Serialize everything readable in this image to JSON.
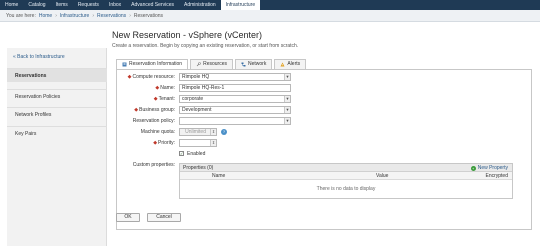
{
  "topnav": {
    "tabs": [
      {
        "label": "Home",
        "active": false
      },
      {
        "label": "Catalog",
        "active": false
      },
      {
        "label": "Items",
        "active": false
      },
      {
        "label": "Requests",
        "active": false
      },
      {
        "label": "Inbox",
        "active": false
      },
      {
        "label": "Advanced Services",
        "active": false
      },
      {
        "label": "Administration",
        "active": false
      },
      {
        "label": "Infrastructure",
        "active": true
      }
    ]
  },
  "breadcrumb": {
    "prefix": "You are here:",
    "items": [
      "Home",
      "Infrastructure",
      "Reservations",
      "Reservations"
    ]
  },
  "sidebar": {
    "back_label": "« Back to Infrastructure",
    "items": [
      {
        "label": "Reservations",
        "active": true
      },
      {
        "label": "Reservation Policies",
        "active": false
      },
      {
        "label": "Network Profiles",
        "active": false
      },
      {
        "label": "Key Pairs",
        "active": false
      }
    ]
  },
  "page": {
    "title": "New Reservation - vSphere (vCenter)",
    "subtitle": "Create a reservation. Begin by copying an existing reservation, or start from scratch."
  },
  "tabs": [
    {
      "label": "Reservation Information",
      "icon": "info-icon",
      "active": true
    },
    {
      "label": "Resources",
      "icon": "wrench-icon",
      "active": false
    },
    {
      "label": "Network",
      "icon": "network-icon",
      "active": false
    },
    {
      "label": "Alerts",
      "icon": "alert-icon",
      "active": false
    }
  ],
  "form": {
    "compute_resource": {
      "label": "Compute resource:",
      "value": "Rimpole HQ"
    },
    "name": {
      "label": "Name:",
      "value": "Rimpole HQ-Res-1"
    },
    "tenant": {
      "label": "Tenant:",
      "value": "corporate"
    },
    "business_group": {
      "label": "Business group:",
      "value": "Development"
    },
    "reservation_policy": {
      "label": "Reservation policy:",
      "value": ""
    },
    "machine_quota": {
      "label": "Machine quota:",
      "value": "Unlimited"
    },
    "priority": {
      "label": "Priority:",
      "value": ""
    },
    "enabled": {
      "label": "Enabled",
      "checked": true
    },
    "custom_properties": {
      "label": "Custom properties:"
    }
  },
  "properties": {
    "title": "Properties (0)",
    "new_label": "New Property",
    "columns": [
      "Name",
      "Value",
      "Encrypted"
    ],
    "empty_text": "There is no data to display"
  },
  "buttons": {
    "ok": "OK",
    "cancel": "Cancel"
  },
  "colors": {
    "nav_bg": "#1f3a55",
    "required": "#c0392b",
    "link": "#2b5b8a"
  }
}
